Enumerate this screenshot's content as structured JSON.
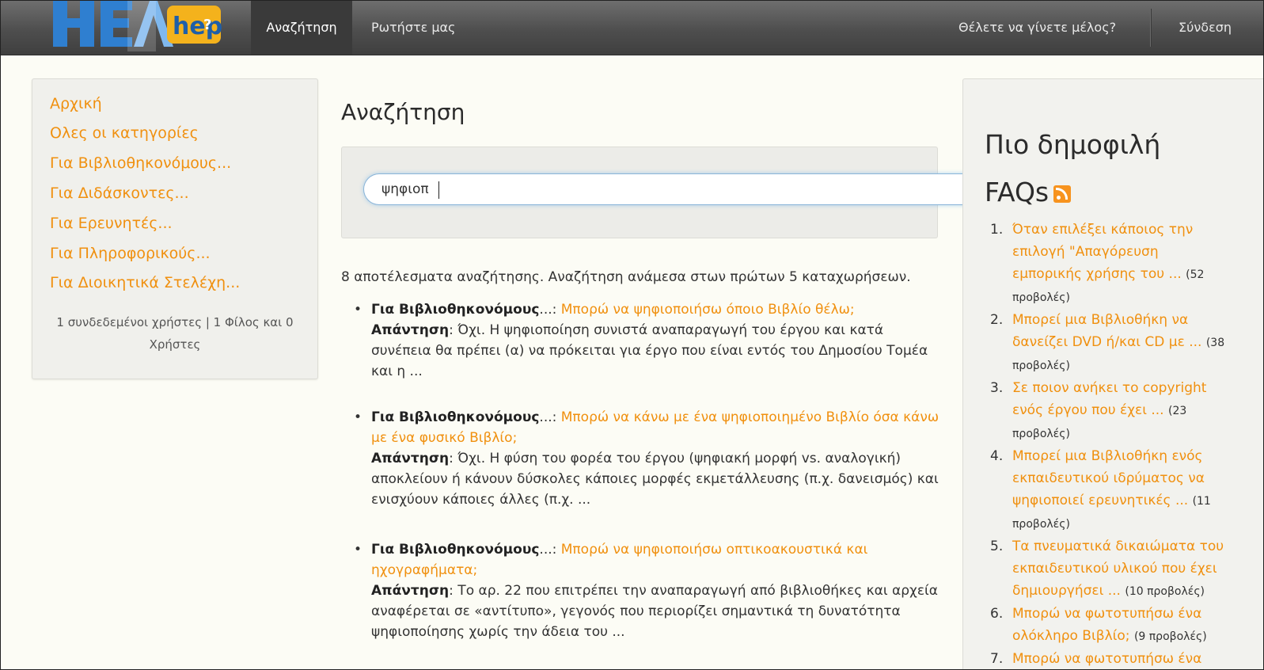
{
  "brand": {
    "logo_text": "HEALhelp",
    "logo_part1": "HEAL",
    "logo_part2": "help"
  },
  "nav": {
    "search": "Αναζήτηση",
    "ask": "Ρωτήστε μας",
    "join": "Θέλετε να γίνετε μέλος?",
    "login": "Σύνδεση"
  },
  "sidebar": {
    "items": [
      {
        "label": "Αρχική"
      },
      {
        "label": "Ολες οι κατηγορίες"
      },
      {
        "label": "Για Βιβλιοθηκονόμους..."
      },
      {
        "label": "Για Διδάσκοντες..."
      },
      {
        "label": "Για Ερευνητές..."
      },
      {
        "label": "Για Πληροφορικούς..."
      },
      {
        "label": "Για Διοικητικά Στελέχη..."
      }
    ],
    "users_line1": "1 συνδεδεμένοι χρήστες | 1 Φίλος και 0",
    "users_line2": "Χρήστες"
  },
  "main": {
    "title": "Αναζήτηση",
    "search_value": "ψηφιοπ",
    "summary": "8 αποτέλεσματα αναζήτησης. Αναζήτηση ανάμεσα στων πρώτων 5 καταχωρήσεων.",
    "results": [
      {
        "category": "Για Βιβλιοθηκονόμους",
        "sep": "...: ",
        "question": "Μπορώ να ψηφιοποιήσω όποιο Βιβλίο θέλω;",
        "answer_label": "Απάντηση",
        "answer": ": Όχι. Η ψηφιοποίηση συνιστά αναπαραγωγή του έργου και κατά συνέπεια θα πρέπει (α) να πρόκειται για έργο που είναι εντός του Δημοσίου Τομέα και η ..."
      },
      {
        "category": "Για Βιβλιοθηκονόμους",
        "sep": "...: ",
        "question": "Μπορώ να κάνω με ένα ψηφιοποιημένο Βιβλίο όσα κάνω με ένα φυσικό Βιβλίο;",
        "answer_label": "Απάντηση",
        "answer": ": Όχι. Η φύση του φορέα του έργου (ψηφιακή μορφή vs. αναλογική) αποκλείουν ή κάνουν δύσκολες κάποιες μορφές εκμετάλλευσης (π.χ. δανεισμός) και ενισχύουν κάποιες άλλες (π.χ. ..."
      },
      {
        "category": "Για Βιβλιοθηκονόμους",
        "sep": "...: ",
        "question": "Μπορώ να ψηφιοποιήσω οπτικοακουστικά και ηχογραφήματα;",
        "answer_label": "Απάντηση",
        "answer": ": Το αρ. 22 που επιτρέπει την αναπαραγωγή από βιβλιοθήκες και αρχεία αναφέρεται σε «αντίτυπο», γεγονός που περιορίζει σημαντικά τη δυνατότητα ψηφιοποίησης χωρίς την άδεια του ..."
      }
    ]
  },
  "popular": {
    "title_line1": "Πιο δημοφιλή",
    "title_line2": "FAQs",
    "items": [
      {
        "num": "1.",
        "question": "Όταν επιλέξει κάποιος την επιλογή \"Απαγόρευση εμπορικής χρήσης του ...",
        "views": "(52 προβολές)"
      },
      {
        "num": "2.",
        "question": "Μπορεί μια Βιβλιοθήκη να δανείζει DVD ή/και CD με ...",
        "views": "(38 προβολές)"
      },
      {
        "num": "3.",
        "question": "Σε ποιον ανήκει το copyright ενός έργου που έχει ...",
        "views": "(23 προβολές)"
      },
      {
        "num": "4.",
        "question": "Μπορεί μια Βιβλιοθήκη ενός εκπαιδευτικού ιδρύματος να ψηφιοποιεί ερευνητικές ...",
        "views": "(11 προβολές)"
      },
      {
        "num": "5.",
        "question": "Τα πνευματικά δικαιώματα του εκπαιδευτικού υλικού που έχει δημιουργήσει ...",
        "views": "(10 προβολές)"
      },
      {
        "num": "6.",
        "question": "Μπορώ να φωτοτυπήσω ένα ολόκληρο Βιβλίο;",
        "views": "(9 προβολές)"
      },
      {
        "num": "7.",
        "question": "Μπορώ να φωτοτυπήσω ένα",
        "views": ""
      }
    ]
  }
}
